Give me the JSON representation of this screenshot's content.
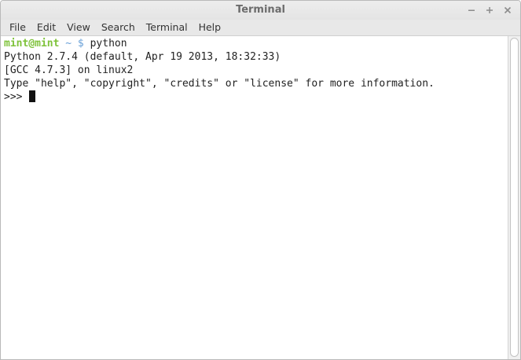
{
  "window": {
    "title": "Terminal"
  },
  "menu": {
    "items": [
      "File",
      "Edit",
      "View",
      "Search",
      "Terminal",
      "Help"
    ]
  },
  "terminal": {
    "prompt_user": "mint@mint",
    "prompt_path": " ~ $",
    "command": " python",
    "lines": [
      "Python 2.7.4 (default, Apr 19 2013, 18:32:33)",
      "[GCC 4.7.3] on linux2",
      "Type \"help\", \"copyright\", \"credits\" or \"license\" for more information."
    ],
    "repl_prompt": ">>> "
  },
  "icons": {
    "minimize": "minimize-icon",
    "maximize": "maximize-icon",
    "close": "close-icon"
  },
  "colors": {
    "prompt_user": "#7ec23a",
    "prompt_path": "#6aa1d8",
    "text": "#222222",
    "background": "#ffffff"
  }
}
